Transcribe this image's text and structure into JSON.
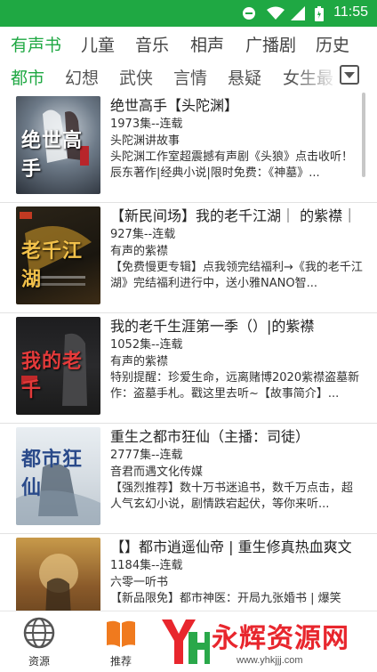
{
  "status_bar": {
    "time": "11:55",
    "bg_color": "#1fa843"
  },
  "category_tabs": [
    {
      "label": "有声书",
      "active": true
    },
    {
      "label": "儿童",
      "active": false
    },
    {
      "label": "音乐",
      "active": false
    },
    {
      "label": "相声",
      "active": false
    },
    {
      "label": "广播剧",
      "active": false
    },
    {
      "label": "历史",
      "active": false
    }
  ],
  "genre_tabs": [
    {
      "label": "都市",
      "active": true
    },
    {
      "label": "幻想",
      "active": false
    },
    {
      "label": "武侠",
      "active": false
    },
    {
      "label": "言情",
      "active": false
    },
    {
      "label": "悬疑",
      "active": false
    },
    {
      "label": "女生最",
      "active": false
    }
  ],
  "books": [
    {
      "title": "绝世高手【头陀渊】",
      "episodes": "1973集--连载",
      "author": "头陀渊讲故事",
      "description": "头陀渊工作室超震撼有声剧《头狼》点击收听！辰东著作|经典小说|限时免费：《神墓》...",
      "cover_text": "绝世高手"
    },
    {
      "title": "【新民间场】我的老千江湖｜ 的紫襟｜",
      "episodes": "927集--连载",
      "author": "有声的紫襟",
      "description": "【免费慢更专辑】点我领完结福利→《我的老千江湖》完结福利进行中，送小雅NANO智...",
      "cover_text": "老千江湖"
    },
    {
      "title": "我的老千生涯第一季（）|的紫襟",
      "episodes": "1052集--连载",
      "author": "有声的紫襟",
      "description": "特别提醒：珍爱生命，远离赌博2020紫襟盗墓新作：盗墓手札。戳这里去听~【故事简介】...",
      "cover_text": "我的老千"
    },
    {
      "title": "重生之都市狂仙（主播：司徒）",
      "episodes": "2777集--连载",
      "author": "音君而遇文化传媒",
      "description": "【强烈推荐】数十万书迷追书，数千万点击，超人气玄幻小说，剧情跌宕起伏，等你来听...",
      "cover_text": "都市狂仙"
    },
    {
      "title": "【】都市逍遥仙帝 | 重生修真热血爽文",
      "episodes": "1184集--连载",
      "author": "六零一听书",
      "description": "【新品限免】都市神医：开局九张婚书 | 爆笑",
      "cover_text": ""
    }
  ],
  "bottom_nav": [
    {
      "label": "资源",
      "icon": "globe-icon"
    },
    {
      "label": "推荐",
      "icon": "book-icon"
    }
  ],
  "watermark": {
    "text": "永辉资源网",
    "url": "www.yhkjjj.com"
  }
}
